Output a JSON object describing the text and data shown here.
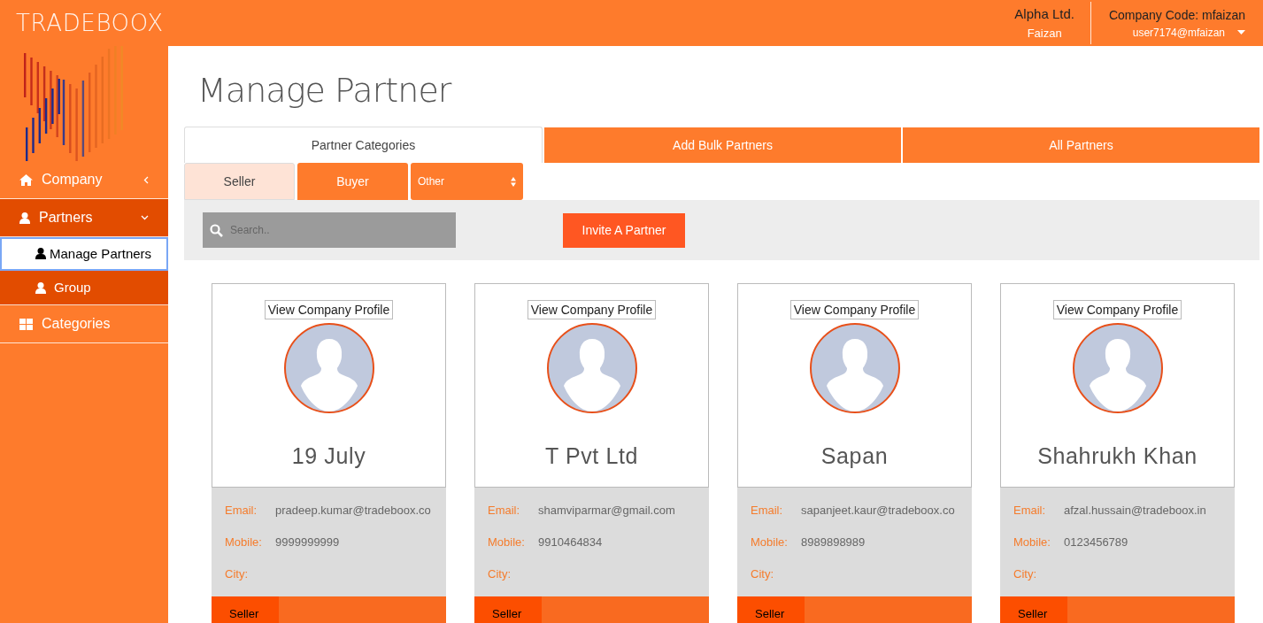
{
  "header": {
    "logo": "TRADEBOOX",
    "company": "Alpha Ltd.",
    "user": "Faizan",
    "company_code": "Company Code: mfaizan",
    "account": "user7174@mfaizan"
  },
  "sidebar": {
    "items": [
      {
        "label": "Company",
        "expanded": false
      },
      {
        "label": "Partners",
        "expanded": true,
        "children": [
          {
            "label": "Manage Partners",
            "selected": true
          },
          {
            "label": "Group",
            "selected": false
          }
        ]
      },
      {
        "label": "Categories"
      }
    ]
  },
  "page_title": "Manage Partner",
  "tabs": [
    {
      "label": "Partner Categories",
      "selected": true
    },
    {
      "label": "Add Bulk Partners",
      "selected": false
    },
    {
      "label": "All Partners",
      "selected": false
    }
  ],
  "sub_tabs": [
    {
      "label": "Seller",
      "selected": true
    },
    {
      "label": "Buyer",
      "selected": false
    }
  ],
  "category_select": {
    "value": "Other"
  },
  "search": {
    "placeholder": "Search.."
  },
  "invite_button": "Invite A Partner",
  "partners": [
    {
      "profile_button": "View Company Profile",
      "name": "19 July",
      "email_label": "Email:",
      "email": "pradeep.kumar@tradeboox.co",
      "mobile_label": "Mobile:",
      "mobile": "9999999999",
      "city_label": "City:",
      "tag": "Seller"
    },
    {
      "profile_button": "View Company Profile",
      "name": "T Pvt Ltd",
      "email_label": "Email:",
      "email": "shamviparmar@gmail.com",
      "mobile_label": "Mobile:",
      "mobile": "9910464834",
      "city_label": "City:",
      "tag": "Seller"
    },
    {
      "profile_button": "View Company Profile",
      "name": "Sapan",
      "email_label": "Email:",
      "email": "sapanjeet.kaur@tradeboox.co",
      "mobile_label": "Mobile:",
      "mobile": "8989898989",
      "city_label": "City:",
      "tag": "Seller"
    },
    {
      "profile_button": "View Company Profile",
      "name": "Shahrukh Khan",
      "email_label": "Email:",
      "email": "afzal.hussain@tradeboox.in",
      "mobile_label": "Mobile:",
      "mobile": "0123456789",
      "city_label": "City:",
      "tag": "Seller"
    }
  ]
}
